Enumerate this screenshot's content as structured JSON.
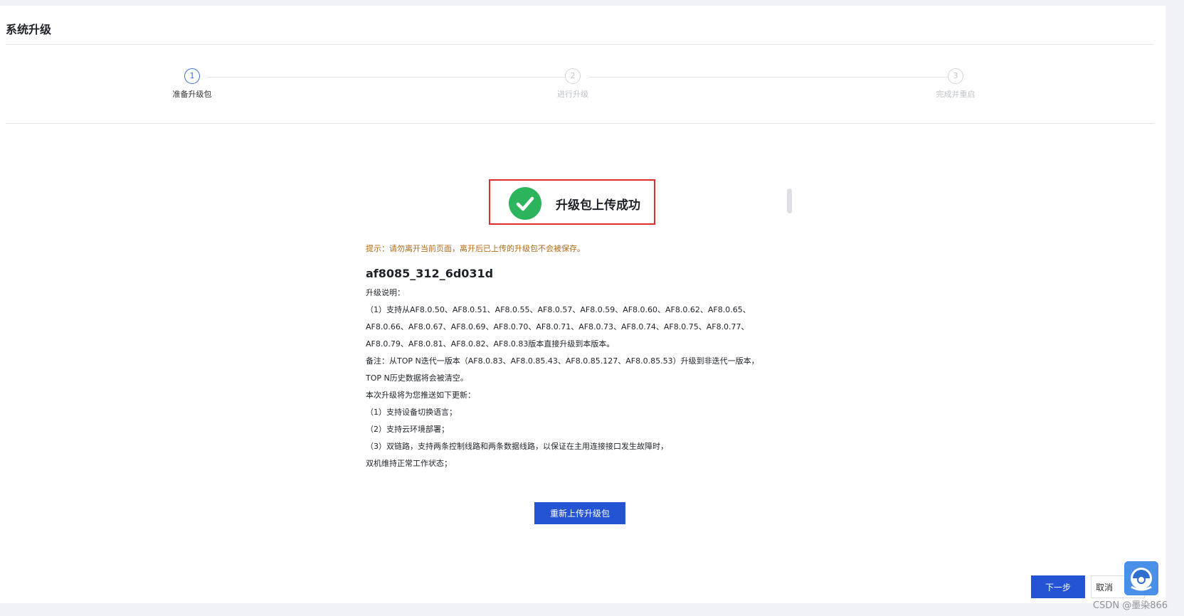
{
  "page": {
    "title": "系统升级"
  },
  "steps": [
    {
      "number": "1",
      "label": "准备升级包"
    },
    {
      "number": "2",
      "label": "进行升级"
    },
    {
      "number": "3",
      "label": "完成并重启"
    }
  ],
  "success": {
    "message": "升级包上传成功",
    "icon": "check-circle-icon",
    "icon_color": "#2db55d",
    "highlight_color": "#e12b2b"
  },
  "hint": "提示：请勿离开当前页面，离开后已上传的升级包不会被保存。",
  "package": {
    "name": "af8085_312_6d031d",
    "notes": [
      "升级说明：",
      "（1）支持从AF8.0.50、AF8.0.51、AF8.0.55、AF8.0.57、AF8.0.59、AF8.0.60、AF8.0.62、AF8.0.65、",
      "AF8.0.66、AF8.0.67、AF8.0.69、AF8.0.70、AF8.0.71、AF8.0.73、AF8.0.74、AF8.0.75、AF8.0.77、",
      "AF8.0.79、AF8.0.81、AF8.0.82、AF8.0.83版本直接升级到本版本。",
      "备注：从TOP N迭代一版本（AF8.0.83、AF8.0.85.43、AF8.0.85.127、AF8.0.85.53）升级到非迭代一版本，",
      "TOP N历史数据将会被清空。",
      "本次升级将为您推送如下更新：",
      "（1）支持设备切换语言；",
      "（2）支持云环境部署；",
      "（3）双链路，支持两条控制线路和两条数据线路，以保证在主用连接接口发生故障时，",
      "双机维持正常工作状态；"
    ]
  },
  "buttons": {
    "reupload": "重新上传升级包",
    "next": "下一步",
    "cancel": "取消"
  },
  "colors": {
    "primary": "#2453d4",
    "hint": "#b46a14"
  },
  "watermark": "CSDN @墨染866"
}
